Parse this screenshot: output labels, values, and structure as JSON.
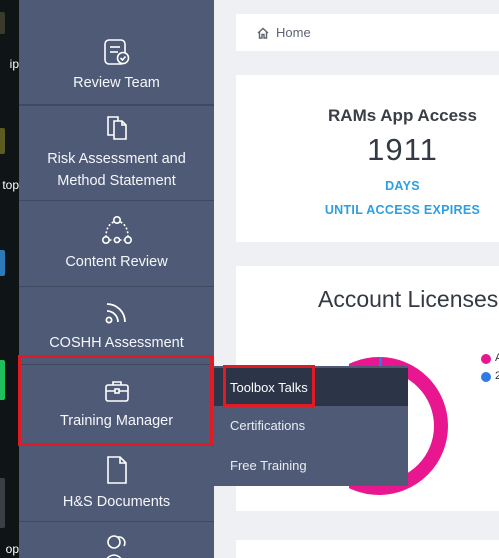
{
  "desktop": {
    "labels": [
      "ip",
      "top",
      "op"
    ]
  },
  "sidebar": {
    "items": [
      {
        "label": "Review Team",
        "icon": "review-document-icon"
      },
      {
        "label": "Risk Assessment and Method Statement",
        "icon": "copy-documents-icon"
      },
      {
        "label": "Content Review",
        "icon": "workflow-icon"
      },
      {
        "label": "COSHH Assessment",
        "icon": "rss-feed-icon"
      },
      {
        "label": "Training Manager",
        "icon": "briefcase-icon"
      },
      {
        "label": "H&S Documents",
        "icon": "document-icon"
      },
      {
        "label": "",
        "icon": "users-icon"
      }
    ]
  },
  "submenu": {
    "items": [
      "Toolbox Talks",
      "Certifications",
      "Free Training"
    ]
  },
  "breadcrumb": {
    "home_label": "Home"
  },
  "access_card": {
    "title": "RAMs App Access",
    "number": "1911",
    "unit": "DAYS",
    "expiry": "UNTIL ACCESS EXPIRES"
  },
  "licenses_card": {
    "title": "Account Licenses",
    "legend": [
      {
        "label": "A",
        "color": "#e8168f"
      },
      {
        "label": "2",
        "color": "#2f7be6"
      }
    ]
  },
  "colors": {
    "sidebar": "#4f5b76",
    "submenu_active": "#2c3447",
    "accent_blue": "#2b9fe0",
    "highlight": "#e01b24",
    "donut_pink": "#e8168f",
    "donut_blue": "#2f7be6"
  }
}
